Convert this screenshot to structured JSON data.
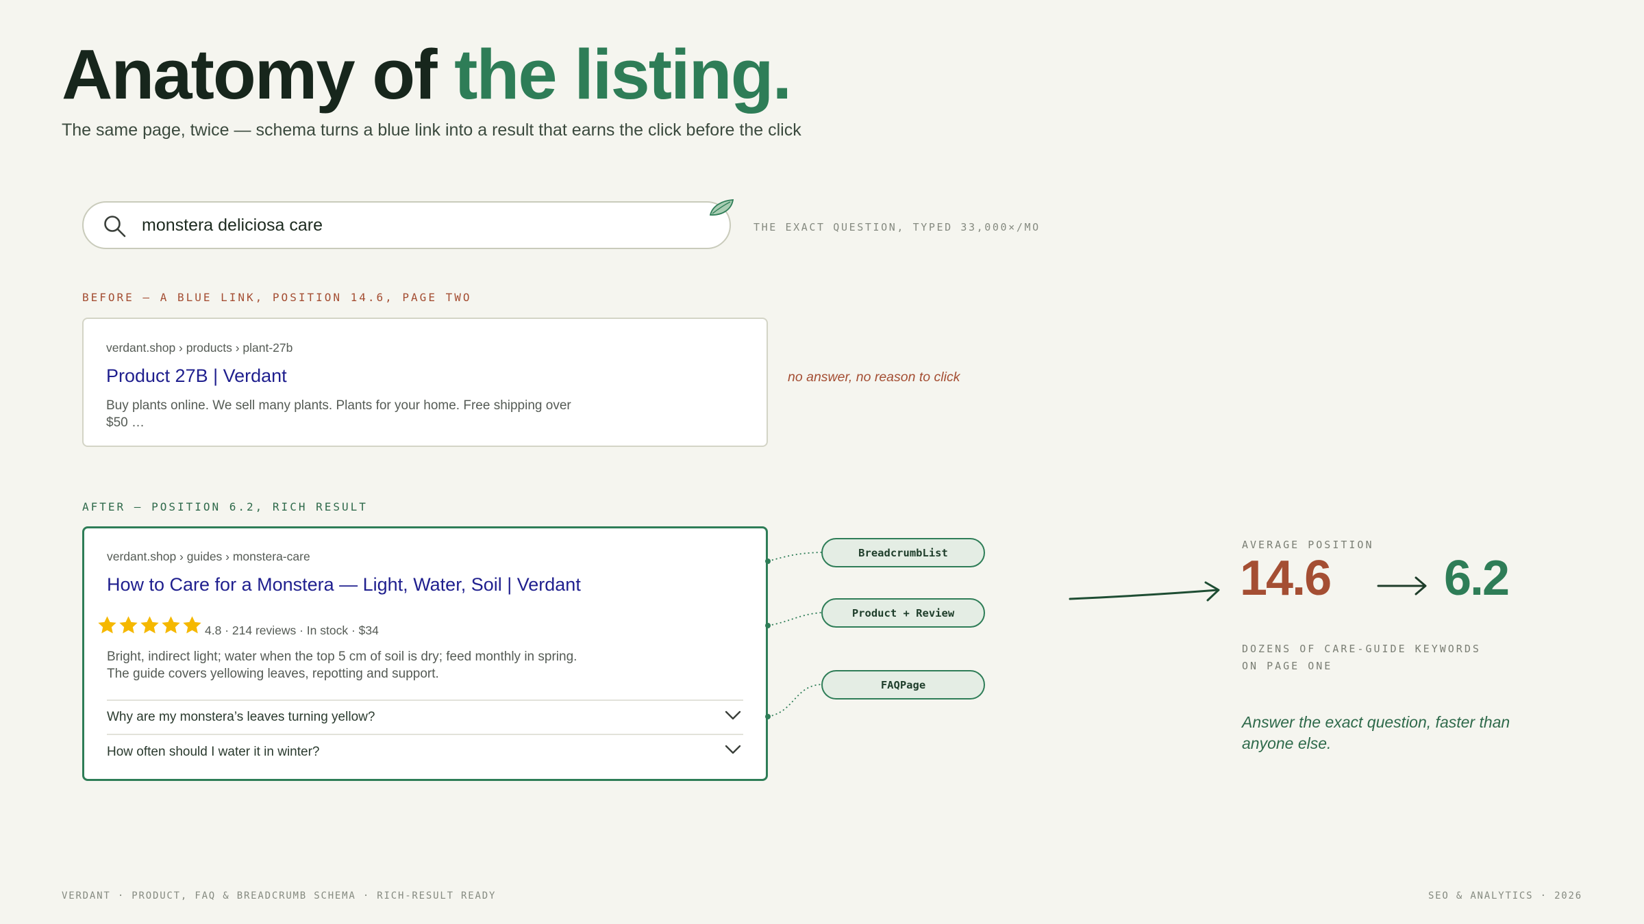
{
  "header": {
    "title_lead": "Anatomy of",
    "title_accent": "the listing.",
    "subtitle": "The same page, twice — schema turns a blue link into a result that earns the click before the click"
  },
  "search": {
    "query": "monstera deliciosa care",
    "note": "THE EXACT QUESTION, TYPED 33,000×/MO"
  },
  "before": {
    "label": "BEFORE — A BLUE LINK, POSITION 14.6, PAGE TWO",
    "breadcrumb": "verdant.shop › products › plant-27b",
    "title": "Product 27B | Verdant",
    "snippet": "Buy plants online. We sell many plants. Plants for your home. Free shipping over $50 …",
    "annotation": "no answer, no reason to click"
  },
  "after": {
    "label": "AFTER — POSITION 6.2, RICH RESULT",
    "breadcrumb": "verdant.shop › guides › monstera-care",
    "title": "How to Care for a Monstera — Light, Water, Soil | Verdant",
    "rating": 4.8,
    "rating_max": 5,
    "meta": "4.8 · 214 reviews · In stock · $34",
    "snippet": "Bright, indirect light; water when the top 5 cm of soil is dry; feed monthly in spring. The guide covers yellowing leaves, repotting and support.",
    "faqs": [
      "Why are my monstera’s leaves turning yellow?",
      "How often should I water it in winter?"
    ]
  },
  "schema_tags": [
    "BreadcrumbList",
    "Product + Review",
    "FAQPage"
  ],
  "kpi": {
    "label": "AVERAGE POSITION",
    "before": "14.6",
    "after": "6.2",
    "note": "DOZENS OF CARE-GUIDE KEYWORDS ON PAGE ONE",
    "tagline": "Answer the exact question, faster than anyone else."
  },
  "footer": {
    "left": "VERDANT · PRODUCT, FAQ & BREADCRUMB SCHEMA · RICH-RESULT READY",
    "right": "SEO & ANALYTICS · 2026"
  },
  "colors": {
    "background": "#f5f5ef",
    "accent_green": "#2e7d57",
    "rust": "#a44e33",
    "link_blue": "#1f1f8e",
    "star_gold": "#f5b800",
    "star_empty": "#d8d8d4"
  },
  "icons": [
    "search-icon",
    "leaf-icon",
    "star-icon",
    "chevron-down-icon",
    "arrow-right-icon"
  ]
}
